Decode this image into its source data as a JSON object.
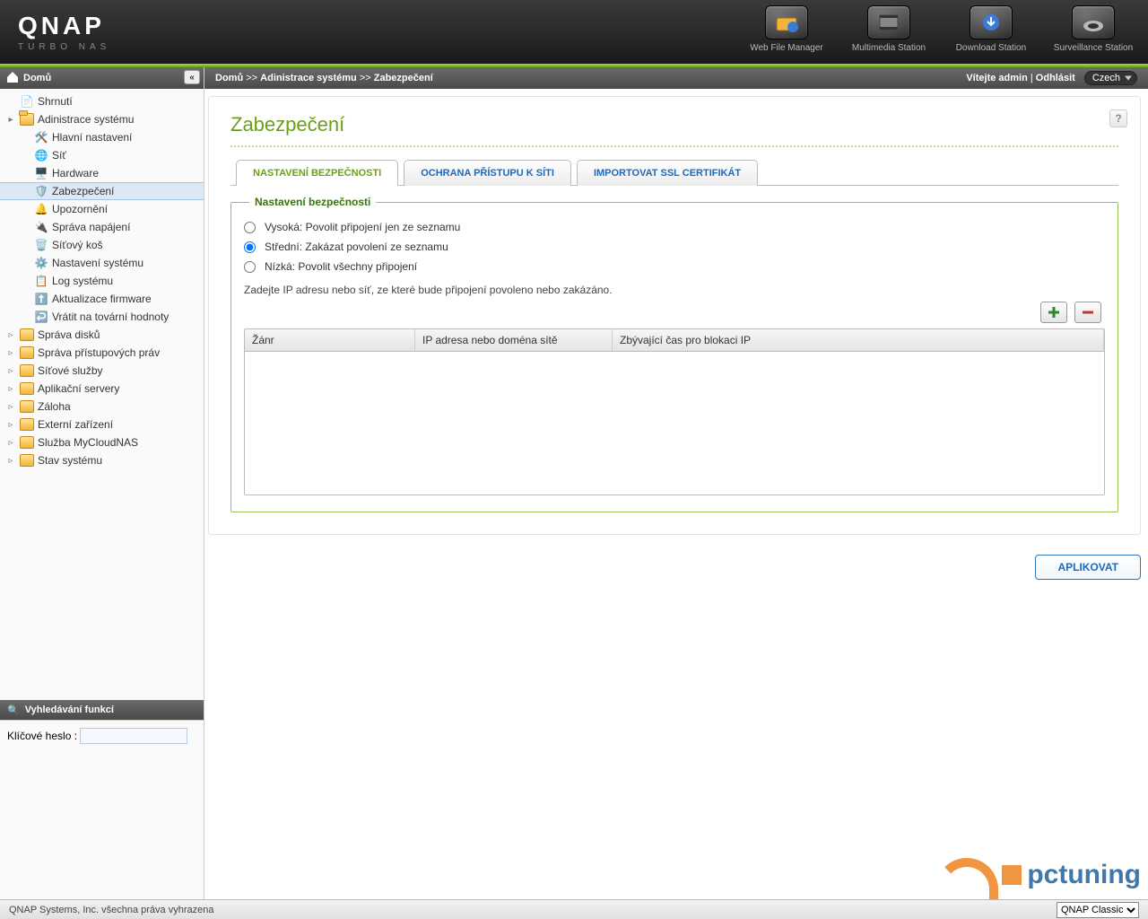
{
  "brand": {
    "name": "QNAP",
    "sub": "TURBO NAS"
  },
  "header_apps": [
    {
      "label": "Web File Manager"
    },
    {
      "label": "Multimedia Station"
    },
    {
      "label": "Download Station"
    },
    {
      "label": "Surveillance Station"
    }
  ],
  "breadcrumb": {
    "home": "Domů",
    "sep": ">>",
    "section": "Adinistrace systému",
    "page": "Zabezpečení"
  },
  "user_bar": {
    "welcome": "Vítejte admin",
    "logout": "Odhlásit",
    "language": "Czech"
  },
  "sidebar": {
    "head": "Domů",
    "items": [
      {
        "label": "Shrnutí",
        "type": "leaf",
        "icon": "summary"
      },
      {
        "label": "Adinistrace systému",
        "type": "folder-open",
        "children": [
          {
            "label": "Hlavní nastavení",
            "icon": "gen"
          },
          {
            "label": "Síť",
            "icon": "net"
          },
          {
            "label": "Hardware",
            "icon": "hw"
          },
          {
            "label": "Zabezpečení",
            "icon": "sec",
            "selected": true
          },
          {
            "label": "Upozornění",
            "icon": "notif"
          },
          {
            "label": "Správa napájení",
            "icon": "power"
          },
          {
            "label": "Síťový koš",
            "icon": "trash"
          },
          {
            "label": "Nastavení systému",
            "icon": "sys"
          },
          {
            "label": "Log systému",
            "icon": "log"
          },
          {
            "label": "Aktualizace firmware",
            "icon": "fw"
          },
          {
            "label": "Vrátit na tovární hodnoty",
            "icon": "reset"
          }
        ]
      },
      {
        "label": "Správa disků",
        "type": "folder"
      },
      {
        "label": "Správa přístupových práv",
        "type": "folder"
      },
      {
        "label": "Síťové služby",
        "type": "folder"
      },
      {
        "label": "Aplikační servery",
        "type": "folder"
      },
      {
        "label": "Záloha",
        "type": "folder"
      },
      {
        "label": "Externí zařízení",
        "type": "folder"
      },
      {
        "label": "Služba MyCloudNAS",
        "type": "folder"
      },
      {
        "label": "Stav systému",
        "type": "folder"
      }
    ],
    "search_head": "Vyhledávání funkcí",
    "search_label": "Klíčové heslo :"
  },
  "page": {
    "title": "Zabezpečení",
    "tabs": [
      {
        "label": "NASTAVENÍ BEZPEČNOSTI",
        "active": true
      },
      {
        "label": "OCHRANA PŘÍSTUPU K SÍTI"
      },
      {
        "label": "IMPORTOVAT SSL CERTIFIKÁT"
      }
    ],
    "fieldset_legend": "Nastavení bezpečnosti",
    "radios": {
      "high": "Vysoká: Povolit připojení jen ze seznamu",
      "medium": "Střední: Zakázat povolení ze seznamu",
      "low": "Nízká: Povolit všechny připojení",
      "selected": "medium"
    },
    "hint": "Zadejte IP adresu nebo síť, ze které bude připojení povoleno nebo zakázáno.",
    "table_headers": {
      "c1": "Žánr",
      "c2": "IP adresa nebo doména sítě",
      "c3": "Zbývající čas pro blokaci IP"
    },
    "apply": "APLIKOVAT"
  },
  "footer": {
    "copyright": "QNAP Systems, Inc. všechna práva vyhrazena",
    "theme_label": "QNAP Classic"
  },
  "watermark": "pctuning"
}
